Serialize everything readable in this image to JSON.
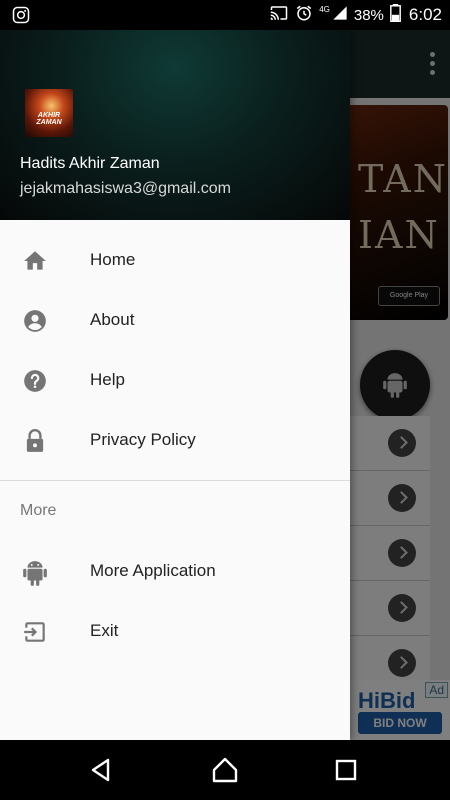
{
  "status_bar": {
    "battery": "38%",
    "time": "6:02",
    "signal_label": "4G",
    "icons": [
      "instagram-icon",
      "cast-icon",
      "alarm-icon",
      "signal-icon",
      "battery-icon"
    ]
  },
  "drawer": {
    "header": {
      "logo_text": "AKHIR ZAMAN",
      "name": "Hadits Akhir Zaman",
      "email": "jejakmahasiswa3@gmail.com"
    },
    "items": [
      {
        "label": "Home",
        "icon": "home-icon"
      },
      {
        "label": "About",
        "icon": "account-circle-icon"
      },
      {
        "label": "Help",
        "icon": "help-icon"
      },
      {
        "label": "Privacy Policy",
        "icon": "lock-icon"
      }
    ],
    "section_title": "More",
    "more_items": [
      {
        "label": "More Application",
        "icon": "android-icon"
      },
      {
        "label": "Exit",
        "icon": "exit-icon"
      }
    ]
  },
  "background": {
    "banner_line1": "TANG",
    "banner_line2": "IAN",
    "store_badge": "Google Play",
    "ad_label": "Ad",
    "ad_brand": "HiBid",
    "ad_button": "BID NOW"
  },
  "colors": {
    "drawer_header_bg": "#0a1f1d",
    "drawer_bg": "#fafafa",
    "icon_color": "#757575"
  }
}
